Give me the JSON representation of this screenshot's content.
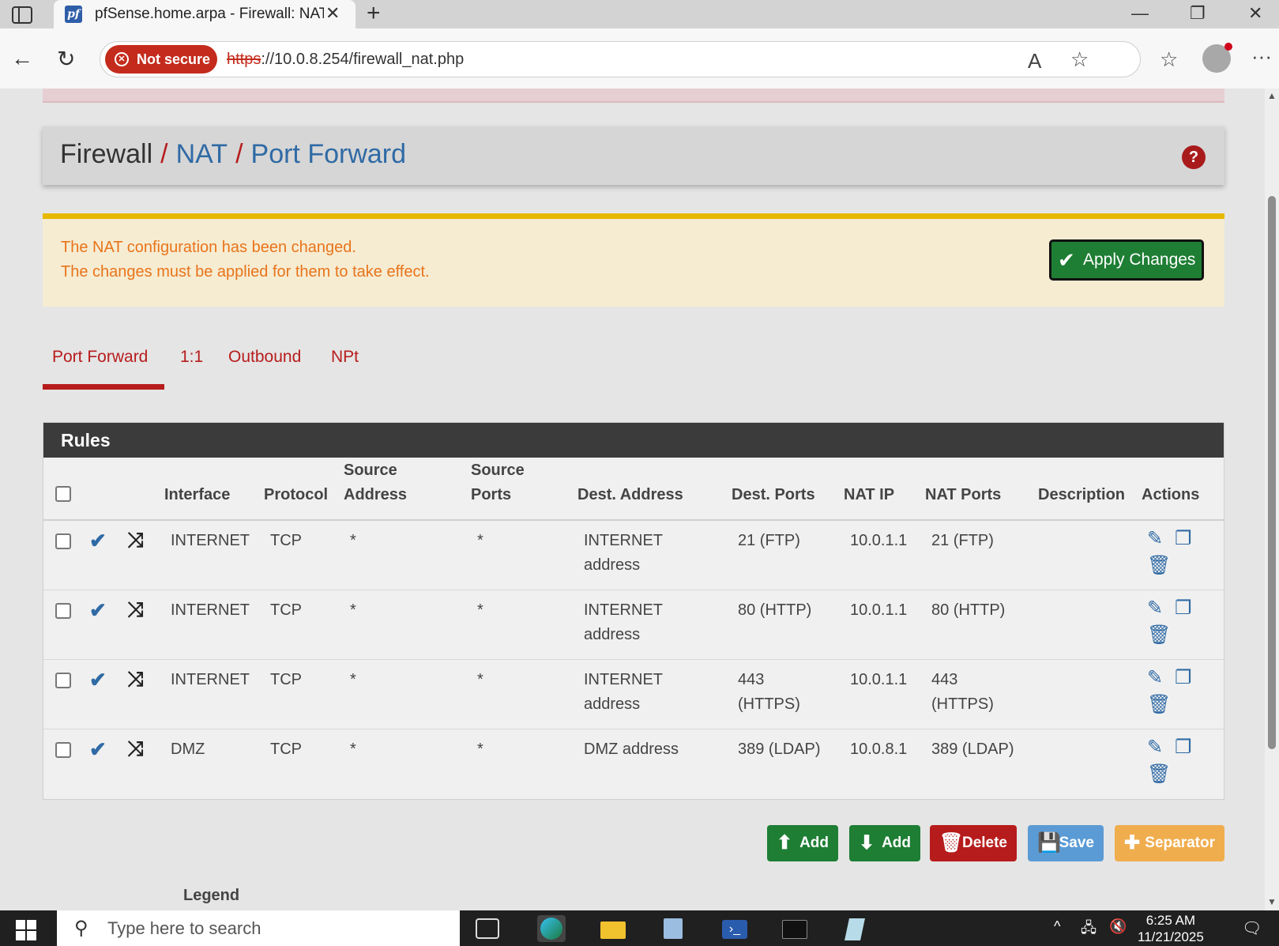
{
  "browser": {
    "tab_title": "pfSense.home.arpa - Firewall: NAT",
    "favicon_text": "pf",
    "security_label": "Not secure",
    "url_protocol": "https",
    "url_rest": "://10.0.8.254/firewall_nat.php"
  },
  "header": {
    "root": "Firewall",
    "sep": "/",
    "crumb1": "NAT",
    "crumb2": "Port Forward",
    "help": "?"
  },
  "alert": {
    "line1": "The NAT configuration has been changed.",
    "line2": "The changes must be applied for them to take effect.",
    "apply_label": "Apply Changes"
  },
  "tabs": [
    "Port Forward",
    "1:1",
    "Outbound",
    "NPt"
  ],
  "panel": {
    "title": "Rules",
    "columns": {
      "interface": "Interface",
      "protocol": "Protocol",
      "source_address_1": "Source",
      "source_address_2": "Address",
      "source_ports_1": "Source",
      "source_ports_2": "Ports",
      "dest_address": "Dest. Address",
      "dest_ports": "Dest. Ports",
      "nat_ip": "NAT IP",
      "nat_ports": "NAT Ports",
      "description": "Description",
      "actions": "Actions"
    },
    "rows": [
      {
        "interface": "INTERNET",
        "protocol": "TCP",
        "src_addr": "*",
        "src_ports": "*",
        "dest_addr_1": "INTERNET",
        "dest_addr_2": "address",
        "dest_ports_1": "21 (FTP)",
        "dest_ports_2": "",
        "nat_ip": "10.0.1.1",
        "nat_ports_1": "21 (FTP)",
        "nat_ports_2": "",
        "description": ""
      },
      {
        "interface": "INTERNET",
        "protocol": "TCP",
        "src_addr": "*",
        "src_ports": "*",
        "dest_addr_1": "INTERNET",
        "dest_addr_2": "address",
        "dest_ports_1": "80 (HTTP)",
        "dest_ports_2": "",
        "nat_ip": "10.0.1.1",
        "nat_ports_1": "80 (HTTP)",
        "nat_ports_2": "",
        "description": ""
      },
      {
        "interface": "INTERNET",
        "protocol": "TCP",
        "src_addr": "*",
        "src_ports": "*",
        "dest_addr_1": "INTERNET",
        "dest_addr_2": "address",
        "dest_ports_1": "443",
        "dest_ports_2": "(HTTPS)",
        "nat_ip": "10.0.1.1",
        "nat_ports_1": "443",
        "nat_ports_2": "(HTTPS)",
        "description": ""
      },
      {
        "interface": "DMZ",
        "protocol": "TCP",
        "src_addr": "*",
        "src_ports": "*",
        "dest_addr_1": "DMZ address",
        "dest_addr_2": "",
        "dest_ports_1": "389 (LDAP)",
        "dest_ports_2": "",
        "nat_ip": "10.0.8.1",
        "nat_ports_1": "389 (LDAP)",
        "nat_ports_2": "",
        "description": ""
      }
    ]
  },
  "buttons": {
    "add_top": "Add",
    "add_bottom": "Add",
    "delete": "Delete",
    "save": "Save",
    "separator": "Separator"
  },
  "legend": "Legend",
  "taskbar": {
    "search_placeholder": "Type here to search",
    "time": "6:25 AM",
    "date": "11/21/2025"
  },
  "colors": {
    "brand_red": "#b71c1c",
    "link_blue": "#2f6aa5",
    "success_green": "#1e7e34",
    "danger_red": "#b71c1c",
    "info_blue": "#5b9bd5",
    "warning_orange": "#f0ad4e",
    "alert_text": "#e8741b"
  }
}
